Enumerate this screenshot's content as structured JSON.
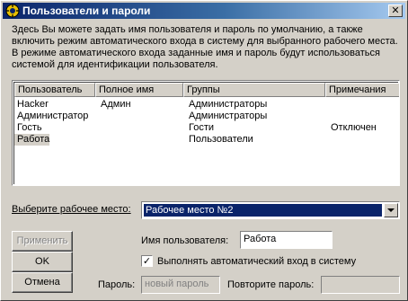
{
  "window": {
    "title": "Пользователи и пароли",
    "close_glyph": "✕"
  },
  "intro_text": "Здесь Вы можете задать имя пользователя и пароль по умолчанию, а также включить режим автоматического входа в систему для выбранного рабочего места. В режиме автоматического входа заданные имя и пароль будут использоваться системой для идентификации пользователя.",
  "users_table": {
    "columns": [
      "Пользователь",
      "Полное имя",
      "Группы",
      "Примечания"
    ],
    "rows": [
      {
        "user": "Hacker",
        "full_name": "Админ",
        "groups": "Администраторы",
        "notes": ""
      },
      {
        "user": "Администратор",
        "full_name": "",
        "groups": "Администраторы",
        "notes": ""
      },
      {
        "user": "Гость",
        "full_name": "",
        "groups": "Гости",
        "notes": "Отключен"
      },
      {
        "user": "Работа",
        "full_name": "",
        "groups": "Пользователи",
        "notes": ""
      }
    ],
    "selected_index": 3
  },
  "workplace": {
    "label": "Выберите рабочее место:",
    "selected": "Рабочее место №2"
  },
  "buttons": {
    "apply": "Применить",
    "ok": "OK",
    "cancel": "Отмена"
  },
  "form": {
    "username_label": "Имя пользователя:",
    "username_value": "Работа",
    "autologin_label": "Выполнять автоматический вход в систему",
    "autologin_checked": true,
    "password_label": "Пароль:",
    "password_placeholder": "новый пароль",
    "password_confirm_label": "Повторите пароль:",
    "password_confirm_value": ""
  },
  "icons": {
    "app_icon": "keys-icon",
    "check_glyph": "✓"
  }
}
